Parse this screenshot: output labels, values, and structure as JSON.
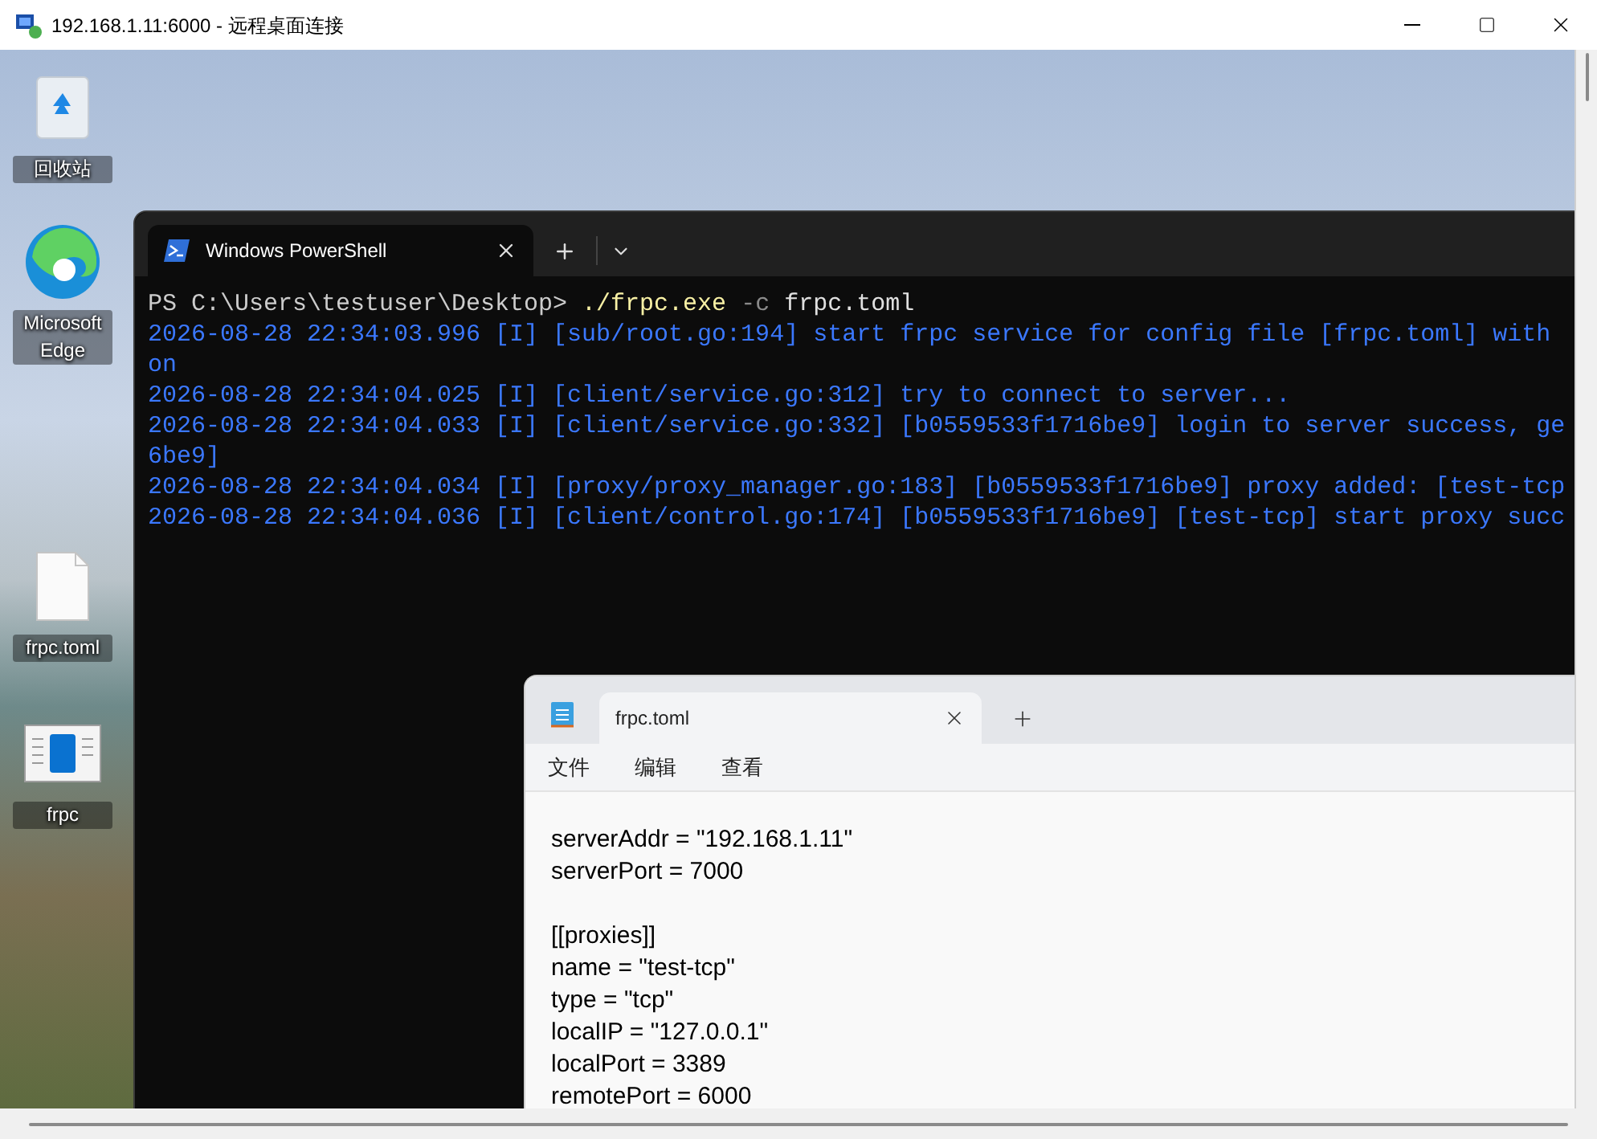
{
  "window": {
    "title": "192.168.1.11:6000 - 远程桌面连接"
  },
  "desktop_icons": [
    {
      "kind": "recycle-bin",
      "label": "回收站"
    },
    {
      "kind": "browser",
      "label": "Microsoft Edge"
    },
    {
      "kind": "file",
      "label": "frpc.toml"
    },
    {
      "kind": "app",
      "label": "frpc"
    }
  ],
  "terminal": {
    "tabs": [
      {
        "title": "Windows PowerShell",
        "selected": true
      }
    ],
    "lines": [
      {
        "kind": "command",
        "parts": [
          {
            "kind": "prompt",
            "text": "PS C:\\Users\\testuser\\Desktop> "
          },
          {
            "kind": "exe",
            "text": "./frpc.exe"
          },
          {
            "kind": "param",
            "text": " -c"
          },
          {
            "kind": "arg",
            "text": " frpc.toml"
          }
        ]
      },
      {
        "kind": "log",
        "text": "2026-08-28 22:34:03.996 [I] [sub/root.go:194] start frpc service for config file [frpc.toml] with"
      },
      {
        "kind": "log",
        "text": "on"
      },
      {
        "kind": "log",
        "text": "2026-08-28 22:34:04.025 [I] [client/service.go:312] try to connect to server..."
      },
      {
        "kind": "log",
        "text": "2026-08-28 22:34:04.033 [I] [client/service.go:332] [b0559533f1716be9] login to server success, ge"
      },
      {
        "kind": "log",
        "text": "6be9]"
      },
      {
        "kind": "log",
        "text": "2026-08-28 22:34:04.034 [I] [proxy/proxy_manager.go:183] [b0559533f1716be9] proxy added: [test-tcp"
      },
      {
        "kind": "log",
        "text": "2026-08-28 22:34:04.036 [I] [client/control.go:174] [b0559533f1716be9] [test-tcp] start proxy succ"
      }
    ]
  },
  "notepad": {
    "tabs": [
      {
        "title": "frpc.toml",
        "selected": true
      }
    ],
    "menu": [
      "文件",
      "编辑",
      "查看"
    ],
    "lines": [
      {
        "kind": "text",
        "text": "serverAddr = \"192.168.1.11\""
      },
      {
        "kind": "text",
        "text": "serverPort = 7000"
      },
      {
        "kind": "blank"
      },
      {
        "kind": "text",
        "text": "[[proxies]]"
      },
      {
        "kind": "text",
        "text": "name = \"test-tcp\""
      },
      {
        "kind": "text",
        "text": "type = \"tcp\""
      },
      {
        "kind": "text",
        "text": "localIP = \"127.0.0.1\""
      },
      {
        "kind": "text",
        "text": "localPort = 3389"
      },
      {
        "kind": "text",
        "text": "remotePort = 6000"
      }
    ]
  }
}
